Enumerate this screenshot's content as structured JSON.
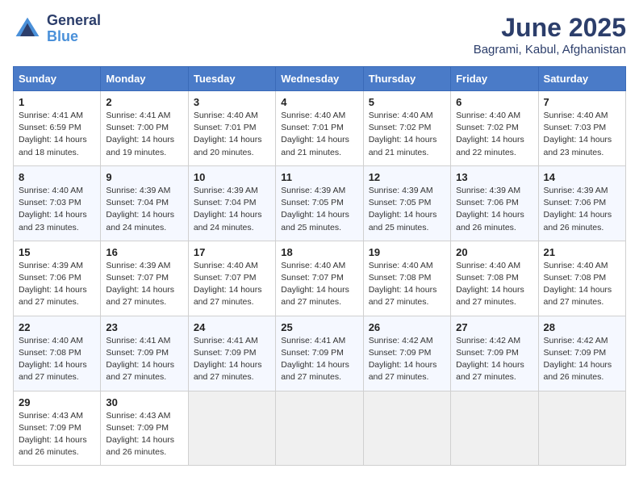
{
  "logo": {
    "general": "General",
    "blue": "Blue"
  },
  "title": "June 2025",
  "subtitle": "Bagrami, Kabul, Afghanistan",
  "days_header": [
    "Sunday",
    "Monday",
    "Tuesday",
    "Wednesday",
    "Thursday",
    "Friday",
    "Saturday"
  ],
  "weeks": [
    [
      {
        "day": "1",
        "sunrise": "Sunrise: 4:41 AM",
        "sunset": "Sunset: 6:59 PM",
        "daylight": "Daylight: 14 hours and 18 minutes."
      },
      {
        "day": "2",
        "sunrise": "Sunrise: 4:41 AM",
        "sunset": "Sunset: 7:00 PM",
        "daylight": "Daylight: 14 hours and 19 minutes."
      },
      {
        "day": "3",
        "sunrise": "Sunrise: 4:40 AM",
        "sunset": "Sunset: 7:01 PM",
        "daylight": "Daylight: 14 hours and 20 minutes."
      },
      {
        "day": "4",
        "sunrise": "Sunrise: 4:40 AM",
        "sunset": "Sunset: 7:01 PM",
        "daylight": "Daylight: 14 hours and 21 minutes."
      },
      {
        "day": "5",
        "sunrise": "Sunrise: 4:40 AM",
        "sunset": "Sunset: 7:02 PM",
        "daylight": "Daylight: 14 hours and 21 minutes."
      },
      {
        "day": "6",
        "sunrise": "Sunrise: 4:40 AM",
        "sunset": "Sunset: 7:02 PM",
        "daylight": "Daylight: 14 hours and 22 minutes."
      },
      {
        "day": "7",
        "sunrise": "Sunrise: 4:40 AM",
        "sunset": "Sunset: 7:03 PM",
        "daylight": "Daylight: 14 hours and 23 minutes."
      }
    ],
    [
      {
        "day": "8",
        "sunrise": "Sunrise: 4:40 AM",
        "sunset": "Sunset: 7:03 PM",
        "daylight": "Daylight: 14 hours and 23 minutes."
      },
      {
        "day": "9",
        "sunrise": "Sunrise: 4:39 AM",
        "sunset": "Sunset: 7:04 PM",
        "daylight": "Daylight: 14 hours and 24 minutes."
      },
      {
        "day": "10",
        "sunrise": "Sunrise: 4:39 AM",
        "sunset": "Sunset: 7:04 PM",
        "daylight": "Daylight: 14 hours and 24 minutes."
      },
      {
        "day": "11",
        "sunrise": "Sunrise: 4:39 AM",
        "sunset": "Sunset: 7:05 PM",
        "daylight": "Daylight: 14 hours and 25 minutes."
      },
      {
        "day": "12",
        "sunrise": "Sunrise: 4:39 AM",
        "sunset": "Sunset: 7:05 PM",
        "daylight": "Daylight: 14 hours and 25 minutes."
      },
      {
        "day": "13",
        "sunrise": "Sunrise: 4:39 AM",
        "sunset": "Sunset: 7:06 PM",
        "daylight": "Daylight: 14 hours and 26 minutes."
      },
      {
        "day": "14",
        "sunrise": "Sunrise: 4:39 AM",
        "sunset": "Sunset: 7:06 PM",
        "daylight": "Daylight: 14 hours and 26 minutes."
      }
    ],
    [
      {
        "day": "15",
        "sunrise": "Sunrise: 4:39 AM",
        "sunset": "Sunset: 7:06 PM",
        "daylight": "Daylight: 14 hours and 27 minutes."
      },
      {
        "day": "16",
        "sunrise": "Sunrise: 4:39 AM",
        "sunset": "Sunset: 7:07 PM",
        "daylight": "Daylight: 14 hours and 27 minutes."
      },
      {
        "day": "17",
        "sunrise": "Sunrise: 4:40 AM",
        "sunset": "Sunset: 7:07 PM",
        "daylight": "Daylight: 14 hours and 27 minutes."
      },
      {
        "day": "18",
        "sunrise": "Sunrise: 4:40 AM",
        "sunset": "Sunset: 7:07 PM",
        "daylight": "Daylight: 14 hours and 27 minutes."
      },
      {
        "day": "19",
        "sunrise": "Sunrise: 4:40 AM",
        "sunset": "Sunset: 7:08 PM",
        "daylight": "Daylight: 14 hours and 27 minutes."
      },
      {
        "day": "20",
        "sunrise": "Sunrise: 4:40 AM",
        "sunset": "Sunset: 7:08 PM",
        "daylight": "Daylight: 14 hours and 27 minutes."
      },
      {
        "day": "21",
        "sunrise": "Sunrise: 4:40 AM",
        "sunset": "Sunset: 7:08 PM",
        "daylight": "Daylight: 14 hours and 27 minutes."
      }
    ],
    [
      {
        "day": "22",
        "sunrise": "Sunrise: 4:40 AM",
        "sunset": "Sunset: 7:08 PM",
        "daylight": "Daylight: 14 hours and 27 minutes."
      },
      {
        "day": "23",
        "sunrise": "Sunrise: 4:41 AM",
        "sunset": "Sunset: 7:09 PM",
        "daylight": "Daylight: 14 hours and 27 minutes."
      },
      {
        "day": "24",
        "sunrise": "Sunrise: 4:41 AM",
        "sunset": "Sunset: 7:09 PM",
        "daylight": "Daylight: 14 hours and 27 minutes."
      },
      {
        "day": "25",
        "sunrise": "Sunrise: 4:41 AM",
        "sunset": "Sunset: 7:09 PM",
        "daylight": "Daylight: 14 hours and 27 minutes."
      },
      {
        "day": "26",
        "sunrise": "Sunrise: 4:42 AM",
        "sunset": "Sunset: 7:09 PM",
        "daylight": "Daylight: 14 hours and 27 minutes."
      },
      {
        "day": "27",
        "sunrise": "Sunrise: 4:42 AM",
        "sunset": "Sunset: 7:09 PM",
        "daylight": "Daylight: 14 hours and 27 minutes."
      },
      {
        "day": "28",
        "sunrise": "Sunrise: 4:42 AM",
        "sunset": "Sunset: 7:09 PM",
        "daylight": "Daylight: 14 hours and 26 minutes."
      }
    ],
    [
      {
        "day": "29",
        "sunrise": "Sunrise: 4:43 AM",
        "sunset": "Sunset: 7:09 PM",
        "daylight": "Daylight: 14 hours and 26 minutes."
      },
      {
        "day": "30",
        "sunrise": "Sunrise: 4:43 AM",
        "sunset": "Sunset: 7:09 PM",
        "daylight": "Daylight: 14 hours and 26 minutes."
      },
      {
        "day": "",
        "sunrise": "",
        "sunset": "",
        "daylight": ""
      },
      {
        "day": "",
        "sunrise": "",
        "sunset": "",
        "daylight": ""
      },
      {
        "day": "",
        "sunrise": "",
        "sunset": "",
        "daylight": ""
      },
      {
        "day": "",
        "sunrise": "",
        "sunset": "",
        "daylight": ""
      },
      {
        "day": "",
        "sunrise": "",
        "sunset": "",
        "daylight": ""
      }
    ]
  ]
}
